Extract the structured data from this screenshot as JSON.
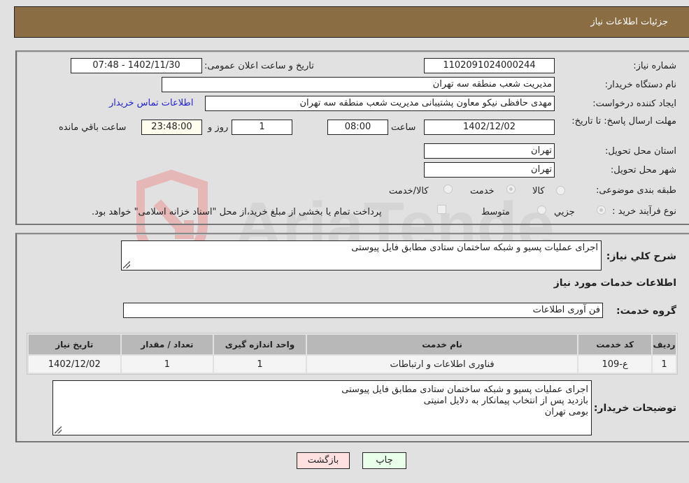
{
  "header": {
    "title": "جزئیات اطلاعات نیاز"
  },
  "form": {
    "need_number": {
      "label": "شماره نیاز:",
      "value": "1102091024000244"
    },
    "announce_datetime": {
      "label": "تاریخ و ساعت اعلان عمومی:",
      "value": "1402/11/30 - 07:48"
    },
    "buyer_org": {
      "label": "نام دستگاه خریدار:",
      "value": "مدیریت شعب منطقه سه تهران"
    },
    "requester": {
      "label": "ایجاد کننده درخواست:",
      "value": "مهدی حافظی نیکو معاون پشتیبانی مدیریت شعب منطقه سه تهران"
    },
    "buyer_contact_link": "اطلاعات تماس خریدار",
    "deadline": {
      "label": "مهلت ارسال پاسخ: تا تاریخ:",
      "date": "1402/12/02",
      "time_label": "ساعت",
      "time": "08:00",
      "days": "1",
      "days_label": "روز و",
      "remaining": "23:48:00",
      "remaining_label": "ساعت باقي مانده"
    },
    "delivery_province": {
      "label": "استان محل تحویل:",
      "value": "تهران"
    },
    "delivery_city": {
      "label": "شهر محل تحویل:",
      "value": "تهران"
    },
    "category": {
      "label": "طبقه بندی موضوعی:",
      "options": [
        "کالا",
        "خدمت",
        "کالا/خدمت"
      ],
      "selected": "خدمت"
    },
    "purchase_type": {
      "label": "نوع فرآیند خرید :",
      "options": [
        "جزيي",
        "متوسط"
      ],
      "selected": "جزيي",
      "treasury_note": "پرداخت تمام یا بخشی از مبلغ خرید،از محل \"اسناد خزانه اسلامی\" خواهد بود."
    }
  },
  "details": {
    "description_label": "شرح كلي نياز:",
    "description": "اجرای عملیات پسیو و شبکه ساختمان ستادی مطابق فایل پیوستی",
    "services_heading": "اطلاعات خدمات مورد نیاز",
    "service_group_label": "گروه خدمت:",
    "service_group": "فن آوری اطلاعات",
    "table": {
      "headers": [
        "ردیف",
        "کد خدمت",
        "نام خدمت",
        "واحد اندازه گیری",
        "تعداد / مقدار",
        "تاریخ نیاز"
      ],
      "rows": [
        [
          "1",
          "ع-109",
          "فناوری اطلاعات و ارتباطات",
          "1",
          "1",
          "1402/12/02"
        ]
      ]
    },
    "buyer_notes_label": "توضیحات خریدار:",
    "buyer_notes": [
      "اجرای عملیات پسیو و شبکه ساختمان ستادی مطابق فایل پیوستی",
      "بازدید پس از انتخاب پیمانکار به دلایل امنیتی",
      "بومی تهران"
    ]
  },
  "buttons": {
    "print": "چاپ",
    "back": "بازگشت"
  },
  "watermark": {
    "text": "AriaTender.neT"
  },
  "colors": {
    "header_bg": "#8b6d43",
    "link": "#2222cc",
    "print_bg": "#eaffea",
    "back_bg": "#ffe0e0"
  }
}
